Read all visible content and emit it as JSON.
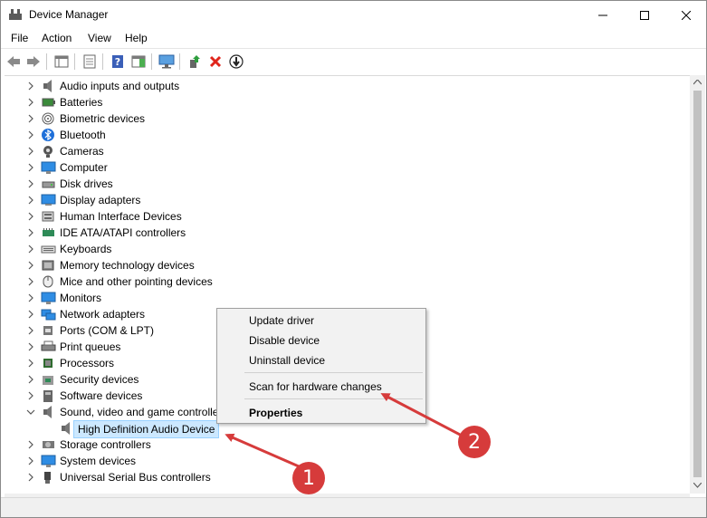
{
  "window": {
    "title": "Device Manager"
  },
  "menu": {
    "file": "File",
    "action": "Action",
    "view": "View",
    "help": "Help"
  },
  "tree": {
    "categories": [
      "Audio inputs and outputs",
      "Batteries",
      "Biometric devices",
      "Bluetooth",
      "Cameras",
      "Computer",
      "Disk drives",
      "Display adapters",
      "Human Interface Devices",
      "IDE ATA/ATAPI controllers",
      "Keyboards",
      "Memory technology devices",
      "Mice and other pointing devices",
      "Monitors",
      "Network adapters",
      "Ports (COM & LPT)",
      "Print queues",
      "Processors",
      "Security devices",
      "Software devices",
      "Sound, video and game controllers",
      "Storage controllers",
      "System devices",
      "Universal Serial Bus controllers"
    ],
    "selected_child": "High Definition Audio Device"
  },
  "context_menu": {
    "update": "Update driver",
    "disable": "Disable device",
    "uninstall": "Uninstall device",
    "scan": "Scan for hardware changes",
    "properties": "Properties"
  },
  "annotations": {
    "badge_1": "1",
    "badge_2": "2",
    "color": "#d63b3b"
  }
}
